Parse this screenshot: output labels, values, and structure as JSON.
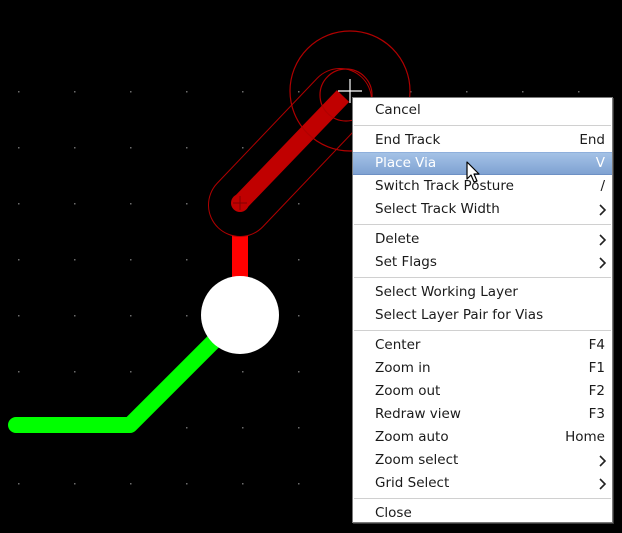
{
  "colors": {
    "background": "#000000",
    "grid_dot": "#6b6b6b",
    "track_active": "#c00000",
    "track_bright_red": "#ff0000",
    "track_green": "#00ff00",
    "pad": "#ffffff",
    "clearance_outline": "#b00000",
    "menu_highlight": "#7fa2d2"
  },
  "context_menu": {
    "groups": [
      [
        {
          "label": "Cancel",
          "shortcut": ""
        }
      ],
      [
        {
          "label": "End Track",
          "shortcut": "End"
        },
        {
          "label": "Place Via",
          "shortcut": "V",
          "highlighted": true
        },
        {
          "label": "Switch Track Posture",
          "shortcut": "/"
        },
        {
          "label": "Select Track Width",
          "shortcut": "",
          "submenu": true
        }
      ],
      [
        {
          "label": "Delete",
          "shortcut": "",
          "submenu": true
        },
        {
          "label": "Set Flags",
          "shortcut": "",
          "submenu": true
        }
      ],
      [
        {
          "label": "Select Working Layer",
          "shortcut": ""
        },
        {
          "label": "Select Layer Pair for Vias",
          "shortcut": ""
        }
      ],
      [
        {
          "label": "Center",
          "shortcut": "F4"
        },
        {
          "label": "Zoom in",
          "shortcut": "F1"
        },
        {
          "label": "Zoom out",
          "shortcut": "F2"
        },
        {
          "label": "Redraw view",
          "shortcut": "F3"
        },
        {
          "label": "Zoom auto",
          "shortcut": "Home"
        },
        {
          "label": "Zoom select",
          "shortcut": "",
          "submenu": true
        },
        {
          "label": "Grid Select",
          "shortcut": "",
          "submenu": true
        }
      ],
      [
        {
          "label": "Close",
          "shortcut": ""
        }
      ]
    ]
  }
}
